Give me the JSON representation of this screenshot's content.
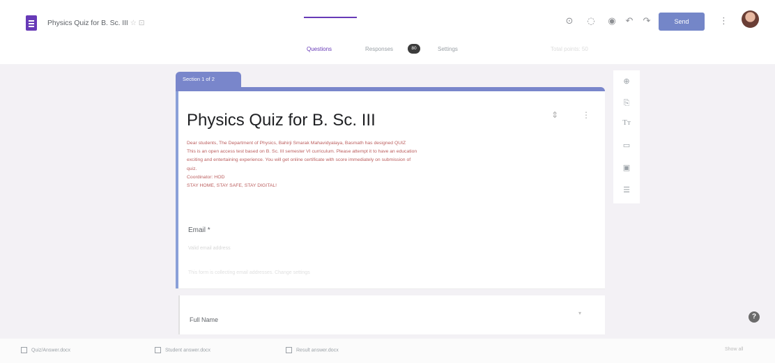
{
  "header": {
    "doc_title": "Physics Quiz for B. Sc. III",
    "doc_title_suffix": "☆ ⊡",
    "send_label": "Send"
  },
  "tabs": [
    {
      "label": "Questions"
    },
    {
      "label": "Responses"
    },
    {
      "label": "Settings"
    }
  ],
  "responses_count": "80",
  "total_points": "Total points: 50",
  "section": {
    "tab_label": "Section 1 of 2"
  },
  "form": {
    "title": "Physics Quiz for B. Sc. III",
    "description_lines": [
      "Dear students, The Department of Physics, Bahirji Smarak Mahavidyalaya, Basmath has designed QUIZ",
      "This is an open access test based on B. Sc. III semester VI curriculum. Please attempt it to have an education",
      "exciting and entertaining experience. You will get online certificate with score immediately on submission of",
      "quiz.",
      "Coordinator: HOD",
      "STAY HOME, STAY SAFE, STAY DIGITAL!"
    ],
    "email_label": "Email *",
    "email_placeholder": "Valid email address",
    "email_note": "This form is collecting email addresses. Change settings"
  },
  "question2": {
    "label": "Full Name"
  },
  "bottom_tray": [
    {
      "label": "Quiz/Answer.docx"
    },
    {
      "label": "Student answer.docx"
    },
    {
      "label": "Result answer.docx"
    }
  ],
  "tray_right": "Show all",
  "colors": {
    "brand": "#673ab7",
    "section": "#7986cb",
    "send": "#7486c8"
  }
}
